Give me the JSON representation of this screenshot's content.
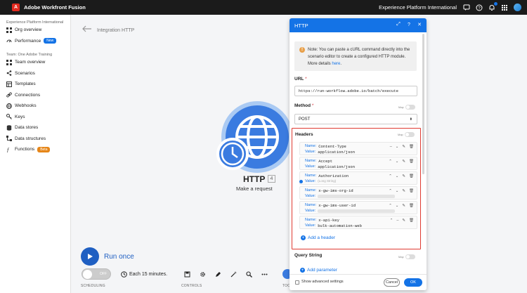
{
  "topbar": {
    "app_title": "Adobe Workfront Fusion",
    "org_name": "Experience Platform International",
    "logo_letter": "A"
  },
  "sidebar": {
    "org_section": "Experience Platform International",
    "org_items": [
      {
        "label": "Org overview",
        "icon": "grid-icon"
      },
      {
        "label": "Performance",
        "icon": "gauge-icon",
        "pill": "New"
      }
    ],
    "team_section": "Team: One Adobe Training",
    "team_items": [
      {
        "label": "Team overview",
        "icon": "grid-icon"
      },
      {
        "label": "Scenarios",
        "icon": "share-icon"
      },
      {
        "label": "Templates",
        "icon": "template-icon"
      },
      {
        "label": "Connections",
        "icon": "link-icon"
      },
      {
        "label": "Webhooks",
        "icon": "globe-icon"
      },
      {
        "label": "Keys",
        "icon": "key-icon"
      },
      {
        "label": "Data stores",
        "icon": "database-icon"
      },
      {
        "label": "Data structures",
        "icon": "structure-icon"
      },
      {
        "label": "Functions",
        "icon": "function-icon",
        "pill": "Beta"
      }
    ]
  },
  "canvas": {
    "breadcrumb": "Integration HTTP",
    "module_title": "HTTP",
    "module_number": "4",
    "module_subtitle": "Make a request",
    "run_label": "Run once",
    "schedule_toggle": "OFF",
    "schedule_label": "Each 15 minutes.",
    "footer_labels": {
      "scheduling": "SCHEDULING",
      "controls": "CONTROLS",
      "tools": "TOO"
    }
  },
  "modal": {
    "title": "HTTP",
    "note": {
      "text": "Note: You can paste a cURL command directly into the scenario editor to create a configured HTTP module. More details ",
      "link": "here",
      "suffix": "."
    },
    "url": {
      "label": "URL",
      "req": "*",
      "value": "https://run-workflow.adobe.io/batch/execute"
    },
    "method": {
      "label": "Method",
      "req": "*",
      "value": "POST",
      "map_label": "Map"
    },
    "headers": {
      "label": "Headers",
      "map_label": "Map",
      "rows": [
        {
          "name": "Content-Type",
          "value": "application/json"
        },
        {
          "name": "Accept",
          "value": "application/json"
        },
        {
          "name": "Authorization",
          "value": "",
          "hint": "(Long String)"
        },
        {
          "name": "x-gw-ims-org-id",
          "value": ""
        },
        {
          "name": "x-gw-ims-user-id",
          "value": ""
        },
        {
          "name": "x-api-key",
          "value": "bulk-automation-web"
        }
      ],
      "name_key": "Name:",
      "value_key": "Value:",
      "add_label": "Add a header"
    },
    "query": {
      "label": "Query String",
      "map_label": "Map",
      "add_label": "Add parameter"
    },
    "footer": {
      "advanced": "Show advanced settings",
      "cancel": "Cancel",
      "ok": "OK"
    }
  }
}
